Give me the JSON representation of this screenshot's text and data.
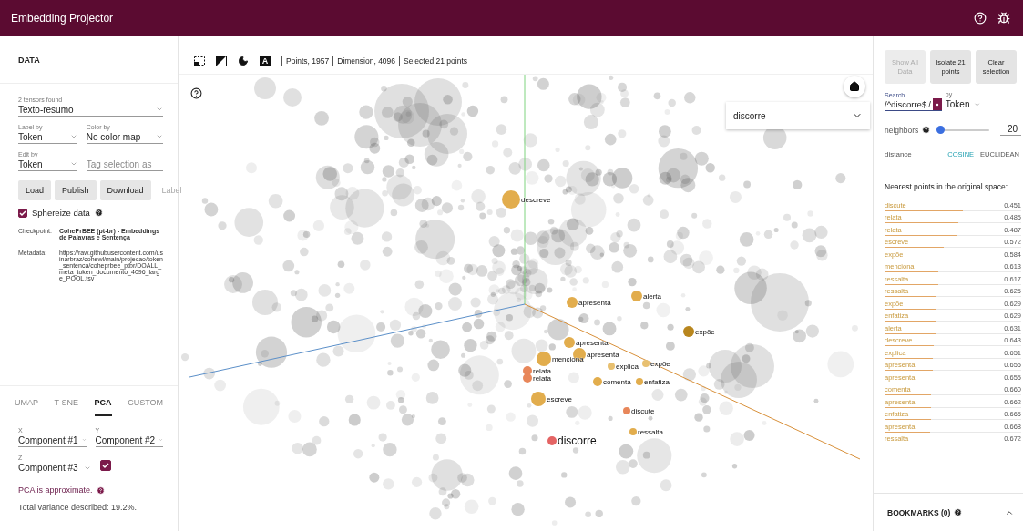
{
  "app_bar": {
    "title": "Embedding Projector"
  },
  "data_panel": {
    "title": "DATA",
    "tensors": {
      "label": "2 tensors found",
      "value": "Texto-resumo"
    },
    "label_by": {
      "label": "Label by",
      "value": "Token"
    },
    "color_by": {
      "label": "Color by",
      "value": "No color map"
    },
    "edit_by": {
      "label": "Edit by",
      "value": "Token"
    },
    "tag_field": {
      "placeholder": "Tag selection as"
    },
    "buttons": [
      {
        "label": "Load",
        "disabled": false
      },
      {
        "label": "Publish",
        "disabled": false
      },
      {
        "label": "Download",
        "disabled": false
      },
      {
        "label": "Label",
        "disabled": true
      }
    ],
    "sphereize": {
      "label": "Sphereize data",
      "checked": true
    },
    "info": [
      {
        "key": "Checkpoint:",
        "value": "CohePrBEE (pt-br) - Embeddings de Palavras e Sentença",
        "bold": true
      },
      {
        "key": "Metadata:",
        "value": "https://raw.githubusercontent.com/usinarbraz/cohewl/main/projecao/token_sentenca/coheprbee_ptbr/DOALL_meta_token_documento_4096_large_POOL.tsv",
        "bold": false
      }
    ]
  },
  "projection_panel": {
    "tabs": [
      {
        "label": "UMAP",
        "selected": false
      },
      {
        "label": "T-SNE",
        "selected": false
      },
      {
        "label": "PCA",
        "selected": true
      },
      {
        "label": "CUSTOM",
        "selected": false
      }
    ],
    "x": {
      "label": "X",
      "value": "Component #1"
    },
    "y": {
      "label": "Y",
      "value": "Component #2"
    },
    "z": {
      "label": "Z",
      "value": "Component #3",
      "checked": true
    },
    "note": "PCA is approximate.",
    "variance": "Total variance described: 19.2%."
  },
  "toolbar": {
    "label_toggle": "A",
    "stats": [
      "Points, 1957",
      "Dimension, 4096",
      "Selected 21 points"
    ]
  },
  "plot": {
    "selector": "discorre",
    "points": [
      {
        "label": "descreve",
        "color": "#e2ad4d",
        "selected": false
      },
      {
        "label": "apresenta",
        "color": "#e2ad4d",
        "selected": false
      },
      {
        "label": "alerta",
        "color": "#e2ad4d",
        "selected": false
      },
      {
        "label": "expõe",
        "color": "#b8861e",
        "selected": false
      },
      {
        "label": "apresenta",
        "color": "#e2ad4d",
        "selected": false
      },
      {
        "label": "apresenta",
        "color": "#e2ad4d",
        "selected": false
      },
      {
        "label": "menciona",
        "color": "#e2ad4d",
        "selected": false
      },
      {
        "label": "relata",
        "color": "#e8875a",
        "selected": false
      },
      {
        "label": "relata",
        "color": "#e8875a",
        "selected": false
      },
      {
        "label": "explica",
        "color": "#e8c070",
        "selected": false
      },
      {
        "label": "expõe",
        "color": "#e8c070",
        "selected": false
      },
      {
        "label": "comenta",
        "color": "#e2ad4d",
        "selected": false
      },
      {
        "label": "enfatiza",
        "color": "#e2ad4d",
        "selected": false
      },
      {
        "label": "escreve",
        "color": "#e2ad4d",
        "selected": false
      },
      {
        "label": "discute",
        "color": "#e8875a",
        "selected": false
      },
      {
        "label": "ressalta",
        "color": "#e2ad4d",
        "selected": false
      },
      {
        "label": "discorre",
        "color": "#e46464",
        "selected": true
      }
    ]
  },
  "inspector": {
    "buttons": [
      {
        "label": "Show All Data",
        "disabled": true
      },
      {
        "label": "Isolate 21 points",
        "disabled": false
      },
      {
        "label": "Clear selection",
        "disabled": false
      }
    ],
    "search": {
      "label": "Search",
      "value": "/^discorre$",
      "suffix": "/",
      "regex_on": true
    },
    "by": {
      "label": "by",
      "value": "Token"
    },
    "neighbors": {
      "label": "neighbors",
      "level": 0.05,
      "value": "20"
    },
    "distance": {
      "label": "distance",
      "options": [
        {
          "label": "COSINE",
          "selected": true
        },
        {
          "label": "EUCLIDEAN",
          "selected": false
        }
      ]
    },
    "nearest": {
      "title": "Nearest points in the original space:",
      "items": [
        {
          "label": "discute",
          "value": "0.451",
          "level": 0.57
        },
        {
          "label": "relata",
          "value": "0.485",
          "level": 0.54
        },
        {
          "label": "relata",
          "value": "0.487",
          "level": 0.53
        },
        {
          "label": "escreve",
          "value": "0.572",
          "level": 0.43
        },
        {
          "label": "expõe",
          "value": "0.584",
          "level": 0.42
        },
        {
          "label": "menciona",
          "value": "0.613",
          "level": 0.39
        },
        {
          "label": "ressalta",
          "value": "0.617",
          "level": 0.39
        },
        {
          "label": "ressalta",
          "value": "0.625",
          "level": 0.38
        },
        {
          "label": "expõe",
          "value": "0.629",
          "level": 0.37
        },
        {
          "label": "enfatiza",
          "value": "0.629",
          "level": 0.37
        },
        {
          "label": "alerta",
          "value": "0.631",
          "level": 0.37
        },
        {
          "label": "descreve",
          "value": "0.643",
          "level": 0.36
        },
        {
          "label": "explica",
          "value": "0.651",
          "level": 0.35
        },
        {
          "label": "apresenta",
          "value": "0.655",
          "level": 0.35
        },
        {
          "label": "apresenta",
          "value": "0.655",
          "level": 0.35
        },
        {
          "label": "comenta",
          "value": "0.660",
          "level": 0.34
        },
        {
          "label": "apresenta",
          "value": "0.662",
          "level": 0.34
        },
        {
          "label": "enfatiza",
          "value": "0.665",
          "level": 0.34
        },
        {
          "label": "apresenta",
          "value": "0.668",
          "level": 0.33
        },
        {
          "label": "ressalta",
          "value": "0.672",
          "level": 0.33
        }
      ]
    }
  },
  "bookmarks": {
    "title": "BOOKMARKS (0)"
  }
}
